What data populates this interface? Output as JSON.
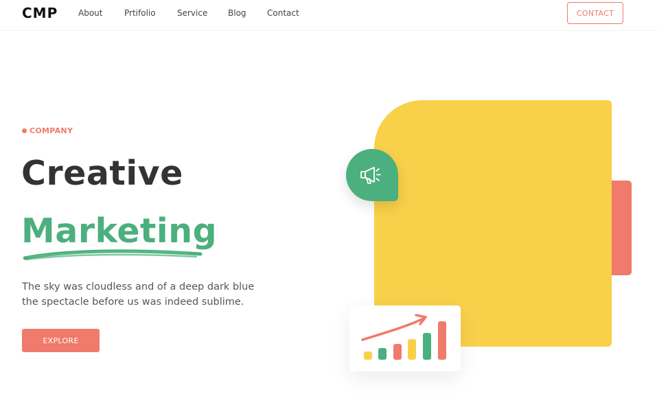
{
  "nav": {
    "logo": "CMP",
    "links": [
      "About",
      "Prtifolio",
      "Service",
      "Blog",
      "Contact"
    ],
    "contact_button": "CONTACT"
  },
  "hero": {
    "eyebrow": "COMPANY",
    "title_line1": "Creative",
    "title_line2": "Marketing",
    "description_line1": "The sky was cloudless and of a deep dark blue",
    "description_line2": "the spectacle before us was indeed sublime.",
    "cta_label": "EXPLORE"
  },
  "illustration": {
    "megaphone_icon": "megaphone-icon",
    "growth_chart_icon": "growth-chart-icon"
  },
  "colors": {
    "accent_red": "#f07a6b",
    "accent_green": "#4caf7e",
    "accent_yellow": "#f9d049",
    "text_dark": "#333333"
  }
}
